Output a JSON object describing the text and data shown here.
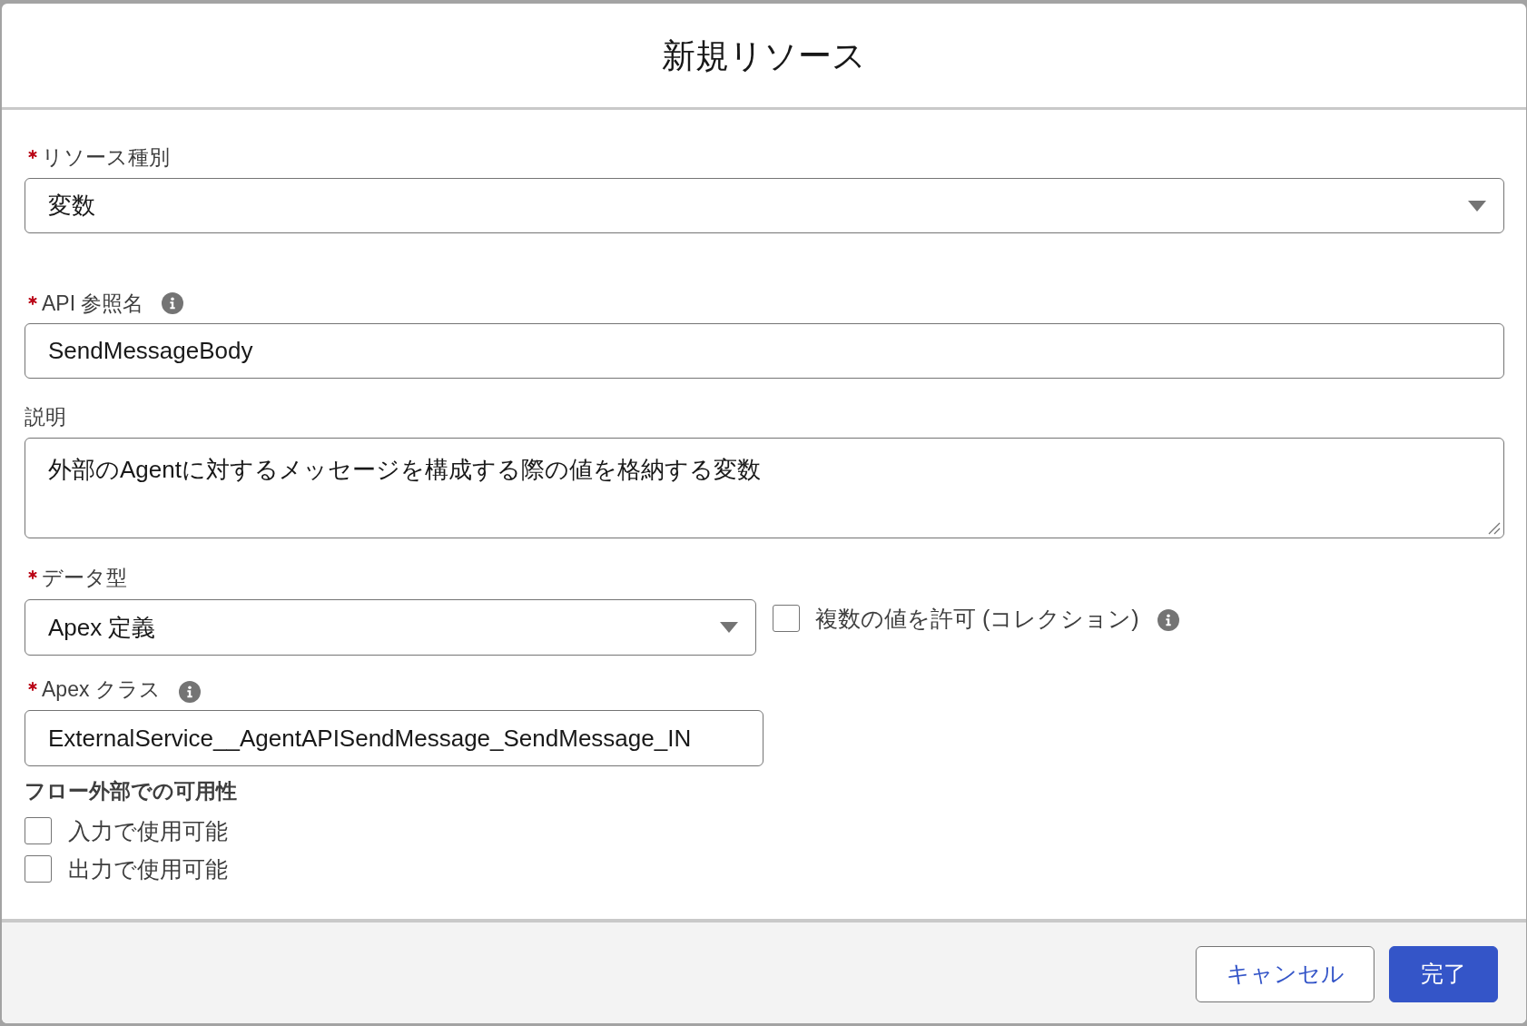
{
  "dialog": {
    "title": "新規リソース"
  },
  "resource_type": {
    "label": "リソース種別",
    "required": true,
    "value": "変数"
  },
  "api_name": {
    "label": "API 参照名",
    "required": true,
    "value": "SendMessageBody"
  },
  "description": {
    "label": "説明",
    "required": false,
    "value": "外部のAgentに対するメッセージを構成する際の値を格納する変数"
  },
  "data_type": {
    "label": "データ型",
    "required": true,
    "value": "Apex 定義"
  },
  "allow_multiple": {
    "label": "複数の値を許可 (コレクション)",
    "checked": false
  },
  "apex_class": {
    "label": "Apex クラス",
    "required": true,
    "value": "ExternalService__AgentAPISendMessage_SendMessage_IN"
  },
  "availability": {
    "title": "フロー外部での可用性",
    "options": [
      {
        "label": "入力で使用可能",
        "checked": false
      },
      {
        "label": "出力で使用可能",
        "checked": false
      }
    ]
  },
  "buttons": [
    {
      "label": "キャンセル",
      "kind": "neutral"
    },
    {
      "label": "完了",
      "kind": "brand"
    }
  ]
}
